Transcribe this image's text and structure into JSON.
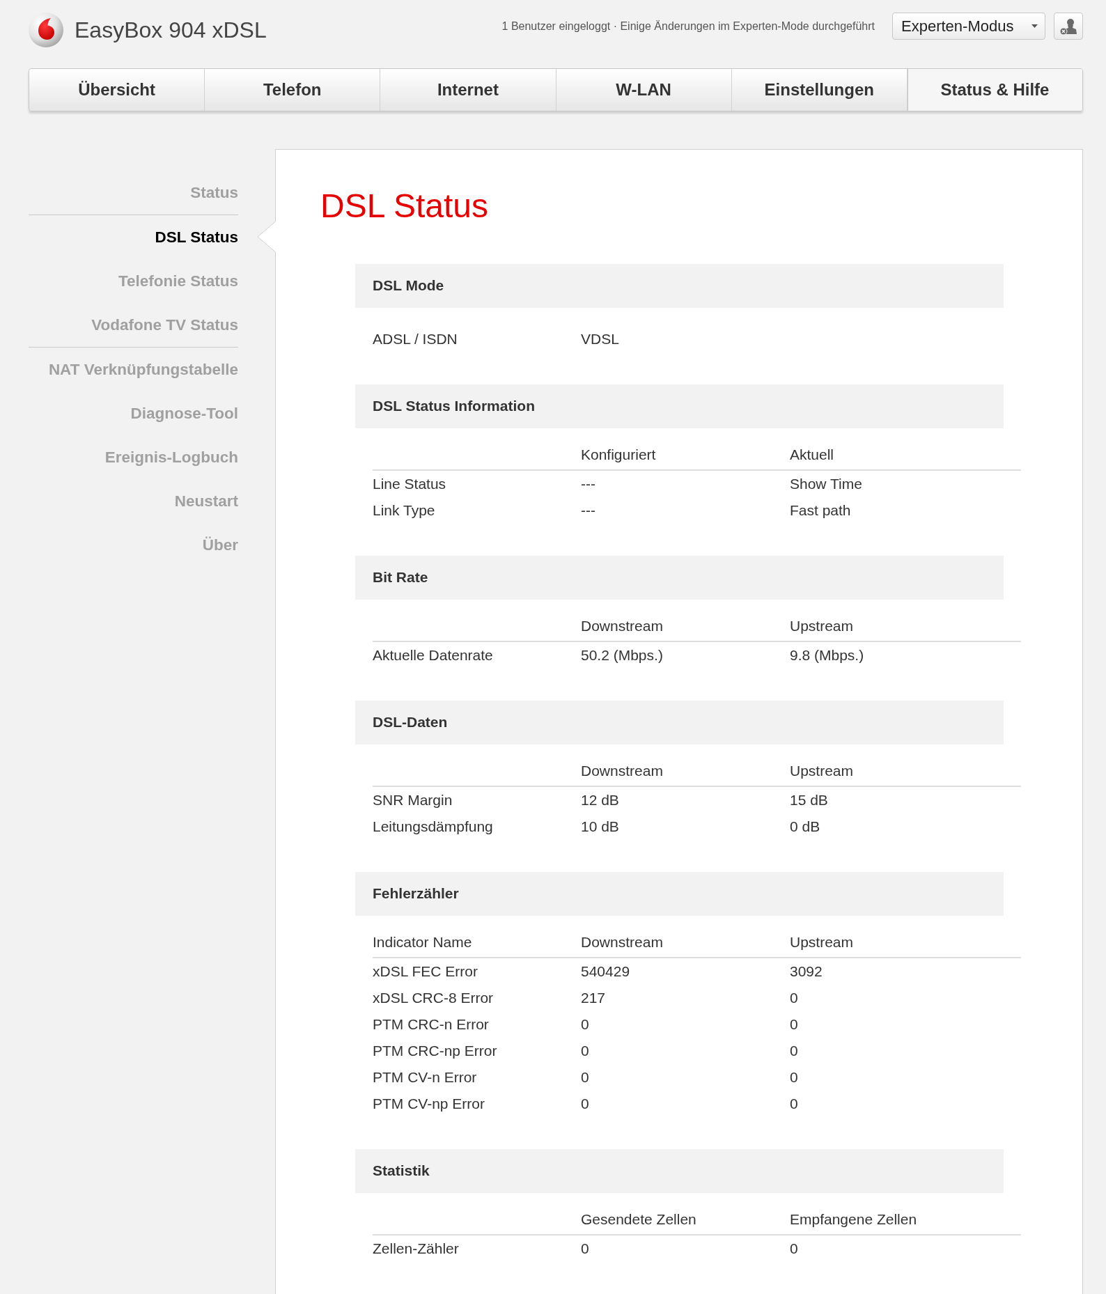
{
  "header": {
    "product_name": "EasyBox 904 xDSL",
    "session_info": "1 Benutzer eingeloggt · Einige Änderungen im Experten-Mode durchgeführt",
    "mode_dropdown": {
      "value": "Experten-Modus"
    }
  },
  "main_nav": {
    "tabs": [
      {
        "label": "Übersicht",
        "selected": false
      },
      {
        "label": "Telefon",
        "selected": false
      },
      {
        "label": "Internet",
        "selected": false
      },
      {
        "label": "W-LAN",
        "selected": false
      },
      {
        "label": "Einstellungen",
        "selected": false
      },
      {
        "label": "Status & Hilfe",
        "selected": true
      }
    ]
  },
  "sidebar": {
    "groups": [
      {
        "items": [
          {
            "label": "Status",
            "selected": false
          }
        ]
      },
      {
        "items": [
          {
            "label": "DSL Status",
            "selected": true
          },
          {
            "label": "Telefonie Status",
            "selected": false
          },
          {
            "label": "Vodafone TV Status",
            "selected": false
          }
        ]
      },
      {
        "items": [
          {
            "label": "NAT Verknüpfungstabelle",
            "selected": false
          },
          {
            "label": "Diagnose-Tool",
            "selected": false
          },
          {
            "label": "Ereignis-Logbuch",
            "selected": false
          },
          {
            "label": "Neustart",
            "selected": false
          },
          {
            "label": "Über",
            "selected": false
          }
        ]
      }
    ]
  },
  "page": {
    "title": "DSL Status",
    "sections": [
      {
        "title": "DSL Mode",
        "rows": [
          [
            "ADSL / ISDN",
            "VDSL"
          ]
        ]
      },
      {
        "title": "DSL Status Information",
        "columns": [
          null,
          "Konfiguriert",
          "Aktuell"
        ],
        "rows": [
          [
            "Line Status",
            "---",
            "Show Time"
          ],
          [
            "Link Type",
            "---",
            "Fast path"
          ]
        ]
      },
      {
        "title": "Bit Rate",
        "columns": [
          null,
          "Downstream",
          "Upstream"
        ],
        "rows": [
          [
            "Aktuelle Datenrate",
            "50.2 (Mbps.)",
            "9.8 (Mbps.)"
          ]
        ]
      },
      {
        "title": "DSL-Daten",
        "columns": [
          null,
          "Downstream",
          "Upstream"
        ],
        "rows": [
          [
            "SNR Margin",
            "12 dB",
            "15 dB"
          ],
          [
            "Leitungsdämpfung",
            "10 dB",
            "0 dB"
          ]
        ]
      },
      {
        "title": "Fehlerzähler",
        "columns": [
          "Indicator Name",
          "Downstream",
          "Upstream"
        ],
        "rows": [
          [
            "xDSL FEC Error",
            "540429",
            "3092"
          ],
          [
            "xDSL CRC-8 Error",
            "217",
            "0"
          ],
          [
            "PTM CRC-n Error",
            "0",
            "0"
          ],
          [
            "PTM CRC-np Error",
            "0",
            "0"
          ],
          [
            "PTM CV-n Error",
            "0",
            "0"
          ],
          [
            "PTM CV-np Error",
            "0",
            "0"
          ]
        ]
      },
      {
        "title": "Statistik",
        "columns": [
          null,
          "Gesendete Zellen",
          "Empfangene Zellen"
        ],
        "rows": [
          [
            "Zellen-Zähler",
            "0",
            "0"
          ]
        ]
      }
    ]
  }
}
